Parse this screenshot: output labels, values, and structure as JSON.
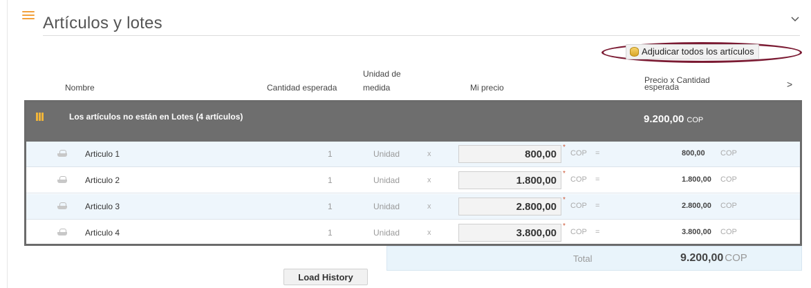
{
  "header": {
    "title": "Artículos y lotes",
    "collapse_icon": "chevron-down-icon"
  },
  "actions": {
    "award_all_label": "Adjudicar todos los artículos"
  },
  "columns": {
    "name": "Nombre",
    "expected_qty": "Cantidad esperada",
    "unit_line1": "Unidad de",
    "unit_line2": "medida",
    "my_price": "Mi precio",
    "price_qty_line1": "Precio x Cantidad",
    "price_qty_line2": "esperada",
    "next_icon": ">"
  },
  "group": {
    "title": "Los artículos no están en Lotes (4 artículos)",
    "total": "9.200,00",
    "currency": "COP"
  },
  "rows": [
    {
      "name": "Articulo 1",
      "qty": "1",
      "unit": "Unidad",
      "x": "x",
      "price": "800,00",
      "req": "*",
      "currency": "COP",
      "eq": "=",
      "total": "800,00",
      "total_currency": "COP"
    },
    {
      "name": "Articulo 2",
      "qty": "1",
      "unit": "Unidad",
      "x": "x",
      "price": "1.800,00",
      "req": "*",
      "currency": "COP",
      "eq": "=",
      "total": "1.800,00",
      "total_currency": "COP"
    },
    {
      "name": "Articulo 3",
      "qty": "1",
      "unit": "Unidad",
      "x": "x",
      "price": "2.800,00",
      "req": "*",
      "currency": "COP",
      "eq": "=",
      "total": "2.800,00",
      "total_currency": "COP"
    },
    {
      "name": "Articulo 4",
      "qty": "1",
      "unit": "Unidad",
      "x": "x",
      "price": "3.800,00",
      "req": "*",
      "currency": "COP",
      "eq": "=",
      "total": "3.800,00",
      "total_currency": "COP"
    }
  ],
  "summary": {
    "total_label": "Total",
    "total_value": "9.200,00",
    "total_currency": "COP"
  },
  "footer": {
    "load_history_label": "Load History"
  },
  "colors": {
    "accent_orange": "#f2a03a",
    "highlight_ring": "#7b1b33",
    "group_bar": "#6e6e6e",
    "row_alt": "#eef6fc"
  }
}
